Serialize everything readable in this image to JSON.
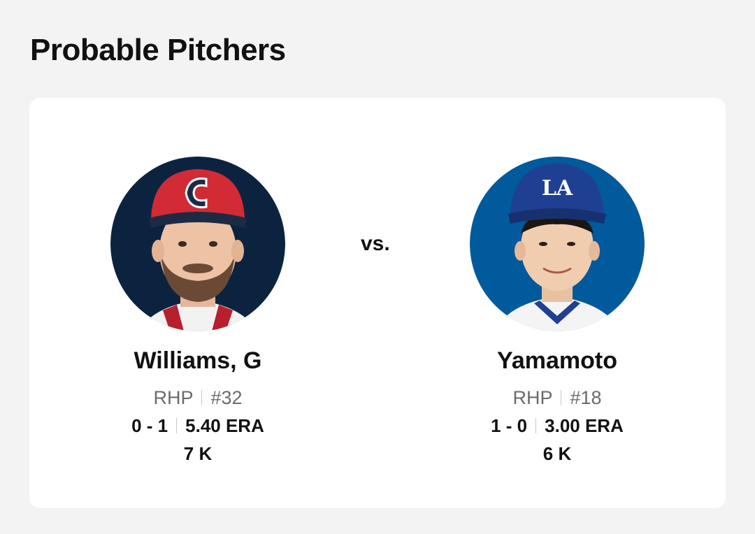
{
  "heading": "Probable Pitchers",
  "vs_label": "vs.",
  "away": {
    "name": "Williams, G",
    "throws": "RHP",
    "number": "#32",
    "record": "0 - 1",
    "era": "5.40 ERA",
    "strikeouts": "7 K",
    "cap_logo": "C",
    "colors": {
      "background": "#0c2340",
      "cap": "#d22b35",
      "brim": "#1d2a44"
    }
  },
  "home": {
    "name": "Yamamoto",
    "throws": "RHP",
    "number": "#18",
    "record": "1 - 0",
    "era": "3.00 ERA",
    "strikeouts": "6 K",
    "cap_logo": "LA",
    "colors": {
      "background": "#005a9c",
      "cap": "#1f3f93",
      "brim": "#17306f"
    }
  }
}
